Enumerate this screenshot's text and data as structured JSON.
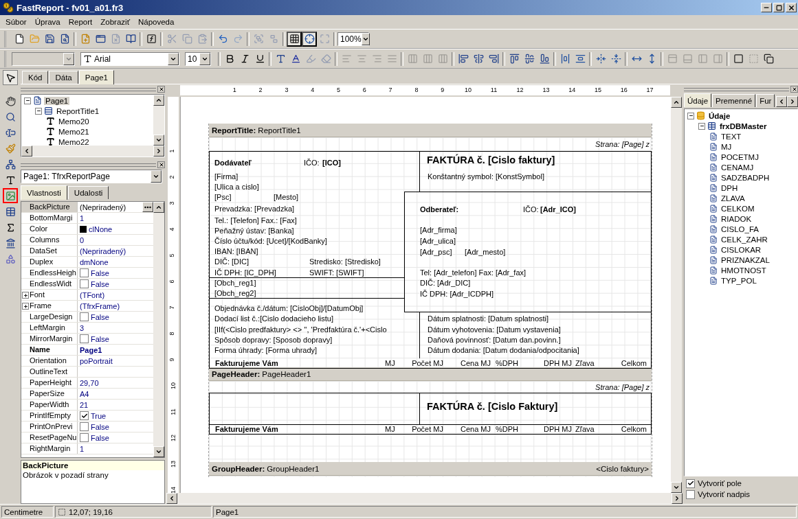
{
  "window": {
    "title": "FastReport - fv01_a01.fr3"
  },
  "menu": [
    "Súbor",
    "Úprava",
    "Report",
    "Zobraziť",
    "Nápoveda"
  ],
  "toolbar_1": [
    {
      "buttons": [
        {
          "kind": "new",
          "disabled": false,
          "pressed": false
        },
        {
          "kind": "open",
          "disabled": false,
          "pressed": false
        },
        {
          "kind": "save",
          "disabled": false,
          "pressed": false
        },
        {
          "kind": "preview",
          "disabled": false,
          "pressed": false
        }
      ]
    },
    {
      "buttons": [
        {
          "kind": "new-page",
          "disabled": false,
          "pressed": false
        },
        {
          "kind": "new-dialog",
          "disabled": false,
          "pressed": false
        },
        {
          "kind": "delete-page",
          "disabled": true,
          "pressed": false
        },
        {
          "kind": "page-settings",
          "disabled": false,
          "pressed": false
        }
      ]
    },
    {
      "buttons": [
        {
          "kind": "expression",
          "disabled": false,
          "pressed": false
        }
      ]
    },
    {
      "buttons": [
        {
          "kind": "cut",
          "disabled": true,
          "pressed": false
        },
        {
          "kind": "copy",
          "disabled": true,
          "pressed": false
        },
        {
          "kind": "paste",
          "disabled": true,
          "pressed": false
        }
      ]
    },
    {
      "buttons": [
        {
          "kind": "undo",
          "disabled": false,
          "pressed": false
        },
        {
          "kind": "redo",
          "disabled": true,
          "pressed": false
        }
      ]
    },
    {
      "buttons": [
        {
          "kind": "group",
          "disabled": true,
          "pressed": false
        },
        {
          "kind": "ungroup",
          "disabled": true,
          "pressed": false
        }
      ]
    },
    {
      "buttons": [
        {
          "kind": "grid",
          "disabled": false,
          "pressed": true
        },
        {
          "kind": "align-grid",
          "disabled": false,
          "pressed": true
        },
        {
          "kind": "fit-grid",
          "disabled": true,
          "pressed": false
        }
      ]
    }
  ],
  "zoom": "100%",
  "font_combo": "Arial",
  "size_combo": "10",
  "toolbar_2": [
    {
      "buttons": [
        {
          "kind": "bold",
          "disabled": false,
          "pressed": false
        },
        {
          "kind": "italic",
          "disabled": false,
          "pressed": false
        },
        {
          "kind": "underline",
          "disabled": false,
          "pressed": false
        }
      ]
    },
    {
      "buttons": [
        {
          "kind": "font-style",
          "disabled": false,
          "pressed": false
        },
        {
          "kind": "font-color",
          "disabled": false,
          "pressed": false
        },
        {
          "kind": "highlight",
          "disabled": true,
          "pressed": false
        },
        {
          "kind": "clear",
          "disabled": true,
          "pressed": false
        }
      ]
    },
    {
      "buttons": [
        {
          "kind": "align-left",
          "disabled": true,
          "pressed": false
        },
        {
          "kind": "align-center",
          "disabled": true,
          "pressed": false
        },
        {
          "kind": "align-right",
          "disabled": true,
          "pressed": false
        },
        {
          "kind": "justify",
          "disabled": true,
          "pressed": false
        }
      ]
    },
    {
      "buttons": [
        {
          "kind": "valign-top",
          "disabled": true,
          "pressed": false
        },
        {
          "kind": "valign-middle",
          "disabled": true,
          "pressed": false
        },
        {
          "kind": "valign-bottom",
          "disabled": true,
          "pressed": false
        }
      ]
    },
    {
      "buttons": [
        {
          "kind": "align-lefts",
          "disabled": false,
          "pressed": false
        },
        {
          "kind": "align-centers",
          "disabled": false,
          "pressed": false
        },
        {
          "kind": "align-rights",
          "disabled": false,
          "pressed": false
        }
      ]
    },
    {
      "buttons": [
        {
          "kind": "align-tops",
          "disabled": false,
          "pressed": false
        },
        {
          "kind": "align-middles",
          "disabled": false,
          "pressed": false
        },
        {
          "kind": "align-bottoms",
          "disabled": false,
          "pressed": false
        }
      ]
    },
    {
      "buttons": [
        {
          "kind": "space-h",
          "disabled": false,
          "pressed": false
        },
        {
          "kind": "space-v",
          "disabled": false,
          "pressed": false
        }
      ]
    },
    {
      "buttons": [
        {
          "kind": "center-h",
          "disabled": false,
          "pressed": false
        },
        {
          "kind": "center-v",
          "disabled": false,
          "pressed": false
        }
      ]
    },
    {
      "buttons": [
        {
          "kind": "same-width",
          "disabled": false,
          "pressed": false
        },
        {
          "kind": "same-height",
          "disabled": false,
          "pressed": false
        }
      ]
    },
    {
      "buttons": [
        {
          "kind": "frame-top",
          "disabled": true,
          "pressed": false
        },
        {
          "kind": "frame-bottom",
          "disabled": true,
          "pressed": false
        },
        {
          "kind": "frame-left",
          "disabled": true,
          "pressed": false
        },
        {
          "kind": "frame-right",
          "disabled": true,
          "pressed": false
        }
      ]
    },
    {
      "buttons": [
        {
          "kind": "frame-all",
          "disabled": false,
          "pressed": false
        },
        {
          "kind": "no-frame",
          "disabled": true,
          "pressed": false
        },
        {
          "kind": "shadow",
          "disabled": false,
          "pressed": false
        }
      ]
    }
  ],
  "tool_palette": [
    {
      "kind": "pointer",
      "selected": true,
      "highlighted": false
    },
    {
      "kind": "hand",
      "selected": false,
      "highlighted": false
    },
    {
      "kind": "zoom",
      "selected": false,
      "highlighted": false
    },
    {
      "kind": "text-edit",
      "selected": false,
      "highlighted": false
    },
    {
      "kind": "format-brush",
      "selected": false,
      "highlighted": false
    },
    {
      "kind": "connector",
      "selected": false,
      "highlighted": false
    },
    {
      "kind": "text",
      "selected": false,
      "highlighted": false
    },
    {
      "kind": "picture",
      "selected": false,
      "highlighted": true
    },
    {
      "kind": "chart",
      "selected": false,
      "highlighted": false
    },
    {
      "kind": "sum",
      "selected": false,
      "highlighted": false
    },
    {
      "kind": "building",
      "selected": false,
      "highlighted": false
    },
    {
      "kind": "shapes",
      "selected": false,
      "highlighted": false
    }
  ],
  "designer_tabs": [
    {
      "label": "Kód",
      "selected": false
    },
    {
      "label": "Dáta",
      "selected": false
    },
    {
      "label": "Page1",
      "selected": true
    }
  ],
  "object_tree": [
    {
      "label": "Page1",
      "kind": "page",
      "selected": true,
      "children": [
        {
          "label": "ReportTitle1",
          "kind": "band",
          "selected": false,
          "children": [
            {
              "label": "Memo20",
              "kind": "memo",
              "selected": false
            },
            {
              "label": "Memo21",
              "kind": "memo",
              "selected": false
            },
            {
              "label": "Memo22",
              "kind": "memo",
              "selected": false
            }
          ]
        }
      ]
    }
  ],
  "object_selector": "Page1: TfrxReportPage",
  "inspector_tabs": [
    {
      "label": "Vlastnosti",
      "selected": true
    },
    {
      "label": "Udalosti",
      "selected": false
    }
  ],
  "properties": [
    {
      "name": "BackPicture",
      "value": "(Nepriradený)",
      "kind": "button",
      "selected": true
    },
    {
      "name": "BottomMargi",
      "value": "1",
      "kind": "text",
      "selected": false
    },
    {
      "name": "Color",
      "value": "clNone",
      "kind": "color",
      "selected": false
    },
    {
      "name": "Columns",
      "value": "0",
      "kind": "text",
      "selected": false
    },
    {
      "name": "DataSet",
      "value": "(Nepriradený)",
      "kind": "text",
      "selected": false
    },
    {
      "name": "Duplex",
      "value": "dmNone",
      "kind": "text",
      "selected": false
    },
    {
      "name": "EndlessHeigh",
      "value": "False",
      "kind": "check",
      "checked": false,
      "selected": false
    },
    {
      "name": "EndlessWidt",
      "value": "False",
      "kind": "check",
      "checked": false,
      "selected": false
    },
    {
      "name": "Font",
      "value": "(TFont)",
      "kind": "expand",
      "selected": false
    },
    {
      "name": "Frame",
      "value": "(TfrxFrame)",
      "kind": "expand",
      "selected": false
    },
    {
      "name": "LargeDesign",
      "value": "False",
      "kind": "check",
      "checked": false,
      "selected": false
    },
    {
      "name": "LeftMargin",
      "value": "3",
      "kind": "text",
      "selected": false
    },
    {
      "name": "MirrorMargin",
      "value": "False",
      "kind": "check",
      "checked": false,
      "selected": false
    },
    {
      "name": "Name",
      "value": "Page1",
      "kind": "name",
      "selected": false
    },
    {
      "name": "Orientation",
      "value": "poPortrait",
      "kind": "text",
      "selected": false
    },
    {
      "name": "OutlineText",
      "kind": "text",
      "selected": false
    },
    {
      "name": "PaperHeight",
      "value": "29,70",
      "kind": "text",
      "selected": false
    },
    {
      "name": "PaperSize",
      "value": "A4",
      "kind": "text",
      "selected": false
    },
    {
      "name": "PaperWidth",
      "value": "21",
      "kind": "text",
      "selected": false
    },
    {
      "name": "PrintIfEmpty",
      "value": "True",
      "kind": "check",
      "checked": true,
      "selected": false
    },
    {
      "name": "PrintOnPrevi",
      "value": "False",
      "kind": "check",
      "checked": false,
      "selected": false
    },
    {
      "name": "ResetPageNu",
      "value": "False",
      "kind": "check",
      "checked": false,
      "selected": false
    },
    {
      "name": "RightMargin",
      "value": "1",
      "kind": "text",
      "selected": false
    }
  ],
  "description": {
    "title": "BackPicture",
    "text": "Obrázok v pozadí strany"
  },
  "ruler": {
    "horizontal": [
      "1",
      "2",
      "3",
      "4",
      "5",
      "6",
      "7",
      "8",
      "9",
      "10",
      "11",
      "12",
      "13",
      "14",
      "15",
      "16",
      "17"
    ],
    "vertical": [
      "1",
      "2",
      "3",
      "4",
      "5",
      "6",
      "7",
      "8",
      "9",
      "10",
      "11",
      "12",
      "13",
      "14"
    ]
  },
  "bands": [
    {
      "type": "ReportTitle:",
      "name": "ReportTitle1",
      "memos": [
        {
          "text": "Strana: [Page] z",
          "kind": "italic"
        },
        {
          "text": "Dodávateľ",
          "kind": "bold"
        },
        {
          "text": "IČO:",
          "kind": "plain"
        },
        {
          "text": "[ICO]",
          "kind": "bold"
        },
        {
          "text": "[Firma]",
          "kind": "plain"
        },
        {
          "text": "[Ulica a cislo]",
          "kind": "plain"
        },
        {
          "text": "[Psc]",
          "kind": "plain"
        },
        {
          "text": "[Mesto]",
          "kind": "plain"
        },
        {
          "text": "Prevadzka: [Prevadzka]",
          "kind": "plain"
        },
        {
          "text": "Tel.: [Telefon]  Fax.: [Fax]",
          "kind": "plain"
        },
        {
          "text": "Peňažný ústav: [Banka]",
          "kind": "plain"
        },
        {
          "text": "Číslo účtu/kód: [Ucet]/[KodBanky]",
          "kind": "plain"
        },
        {
          "text": "IBAN: [IBAN]",
          "kind": "plain"
        },
        {
          "text": "DIČ: [DIC]",
          "kind": "plain"
        },
        {
          "text": "Stredisko: [Stredisko]",
          "kind": "plain"
        },
        {
          "text": "IČ DPH: [IC_DPH]",
          "kind": "plain"
        },
        {
          "text": "SWIFT: [SWIFT]",
          "kind": "plain"
        },
        {
          "text": "[Obch_reg1]",
          "kind": "plain"
        },
        {
          "text": "[Obch_reg2]",
          "kind": "plain"
        },
        {
          "text": "Objednávka č./dátum: [CisloObj]/[DatumObj]",
          "kind": "plain"
        },
        {
          "text": "Dodací list č.:[Cislo dodacieho listu]",
          "kind": "plain"
        },
        {
          "text": "[IIf(<Cislo predfaktury> <> '', 'Predfaktúra č.'+<Cislo",
          "kind": "plain"
        },
        {
          "text": "Spôsob dopravy: [Sposob dopravy]",
          "kind": "plain"
        },
        {
          "text": "Forma úhrady: [Forma uhrady]",
          "kind": "plain"
        },
        {
          "text": "FAKTÚRA č. [Cislo faktury]",
          "kind": "title"
        },
        {
          "text": "Konštantný symbol: [KonstSymbol]",
          "kind": "plain"
        },
        {
          "text": "Odberateľ:",
          "kind": "bold"
        },
        {
          "text": "IČO:",
          "kind": "plain"
        },
        {
          "text": "[Adr_ICO]",
          "kind": "bold"
        },
        {
          "text": "[Adr_firma]",
          "kind": "plain"
        },
        {
          "text": "[Adr_ulica]",
          "kind": "plain"
        },
        {
          "text": "[Adr_psc]",
          "kind": "plain"
        },
        {
          "text": "[Adr_mesto]",
          "kind": "plain"
        },
        {
          "text": "Tel: [Adr_telefon]    Fax: [Adr_fax]",
          "kind": "plain"
        },
        {
          "text": "DIČ: [Adr_DIC]",
          "kind": "plain"
        },
        {
          "text": "IČ DPH: [Adr_ICDPH]",
          "kind": "plain"
        },
        {
          "text": "Dátum splatnosti: [Datum splatnosti]",
          "kind": "plain"
        },
        {
          "text": "Dátum vyhotovenia: [Datum vystavenia]",
          "kind": "plain"
        },
        {
          "text": "Daňová povinnosť: [Datum dan.povinn.]",
          "kind": "plain"
        },
        {
          "text": "Dátum dodania: [Datum dodania/odpocitania]",
          "kind": "plain"
        }
      ],
      "columns": [
        "Fakturujeme Vám",
        "MJ",
        "Počet MJ",
        "Cena MJ",
        "%DPH",
        "DPH MJ",
        "Zľava",
        "Celkom"
      ]
    },
    {
      "type": "PageHeader:",
      "name": "PageHeader1",
      "memos": [
        {
          "text": "Strana: [Page] z",
          "kind": "italic"
        },
        {
          "text": "FAKTÚRA č. [Cislo Faktury]",
          "kind": "title"
        }
      ],
      "columns": [
        "Fakturujeme Vám",
        "MJ",
        "Počet MJ",
        "Cena MJ",
        "%DPH",
        "DPH MJ",
        "Zľava",
        "Celkom"
      ]
    },
    {
      "type": "GroupHeader:",
      "name": "GroupHeader1",
      "condition": "<Cislo faktury>"
    }
  ],
  "data_tabs": [
    {
      "label": "Údaje",
      "selected": true
    },
    {
      "label": "Premenné",
      "selected": false
    },
    {
      "label": "Fur",
      "selected": false
    }
  ],
  "data_tree": [
    {
      "label": "Údaje",
      "kind": "root",
      "children": [
        {
          "label": "frxDBMaster",
          "kind": "dataset",
          "children": [
            {
              "label": "TEXT",
              "kind": "field"
            },
            {
              "label": "MJ",
              "kind": "field"
            },
            {
              "label": "POCETMJ",
              "kind": "field"
            },
            {
              "label": "CENAMJ",
              "kind": "field"
            },
            {
              "label": "SADZBADPH",
              "kind": "field"
            },
            {
              "label": "DPH",
              "kind": "field"
            },
            {
              "label": "ZLAVA",
              "kind": "field"
            },
            {
              "label": "CELKOM",
              "kind": "field"
            },
            {
              "label": "RIADOK",
              "kind": "field"
            },
            {
              "label": "CISLO_FA",
              "kind": "field"
            },
            {
              "label": "CELK_ZAHR",
              "kind": "field"
            },
            {
              "label": "CISLOKAR",
              "kind": "field"
            },
            {
              "label": "PRIZNAKZAL",
              "kind": "field"
            },
            {
              "label": "HMOTNOST",
              "kind": "field"
            },
            {
              "label": "TYP_POL",
              "kind": "field"
            }
          ]
        }
      ]
    }
  ],
  "data_options": [
    {
      "label": "Vytvoriť pole",
      "checked": true
    },
    {
      "label": "Vytvoriť nadpis",
      "checked": false
    }
  ],
  "status_bar": {
    "units": "Centimetre",
    "position": "12,07; 19,16",
    "page": "Page1"
  }
}
